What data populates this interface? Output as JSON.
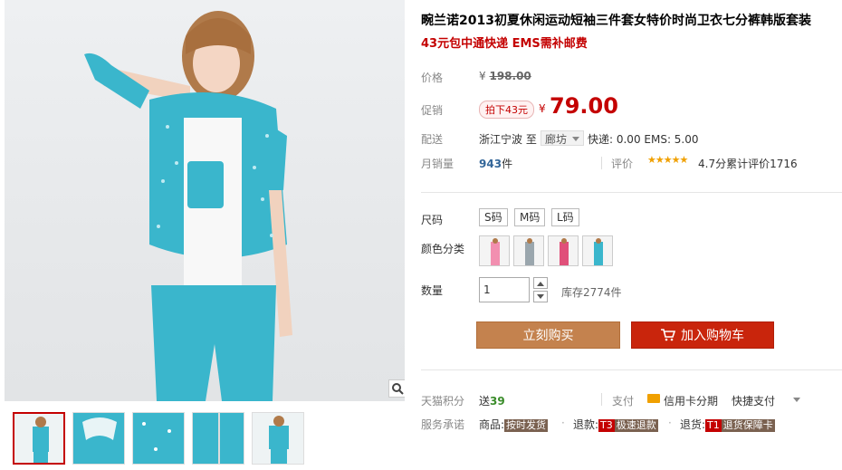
{
  "product": {
    "title": "畹兰诺2013初夏休闲运动短袖三件套女特价时尚卫衣七分裤韩版套装",
    "subtitle": "43元包中通快递 EMS需补邮费"
  },
  "price": {
    "label": "价格",
    "currency": "¥",
    "original": "198.00",
    "promo_label": "促销",
    "promo_tag": "拍下43元",
    "promo_price": "79.00"
  },
  "shipping": {
    "label": "配送",
    "from": "浙江宁波",
    "to_word": "至",
    "destination": "廊坊",
    "fees": "快递: 0.00 EMS: 5.00"
  },
  "sales": {
    "label": "月销量",
    "count": "943",
    "unit": "件",
    "rating_label": "评价",
    "stars": "★★★★★",
    "rating_text": "4.7分累计评价1716"
  },
  "options": {
    "size_label": "尺码",
    "sizes": [
      "S码",
      "M码",
      "L码"
    ],
    "color_label": "颜色分类",
    "quantity_label": "数量",
    "quantity_value": "1",
    "stock": "库存2774件"
  },
  "actions": {
    "buy_now": "立刻购买",
    "add_to_cart": "加入购物车"
  },
  "services": {
    "points_label": "天猫积分",
    "points_prefix": "送",
    "points_value": "39",
    "pay_label": "支付",
    "credit_card": "信用卡分期",
    "fast_pay": "快捷支付",
    "promise_label": "服务承诺",
    "goods_prefix": "商品:",
    "goods_tag": "按时发货",
    "refund_prefix": "退款:",
    "refund_code": "T3",
    "refund_tag": "极速退款",
    "return_prefix": "退货:",
    "return_code": "T1",
    "return_tag": "退货保障卡"
  },
  "colors": {
    "price_red": "#c40000",
    "buy_orange": "#c4824e",
    "cart_red": "#c9250c",
    "teal": "#3ab6cc"
  }
}
